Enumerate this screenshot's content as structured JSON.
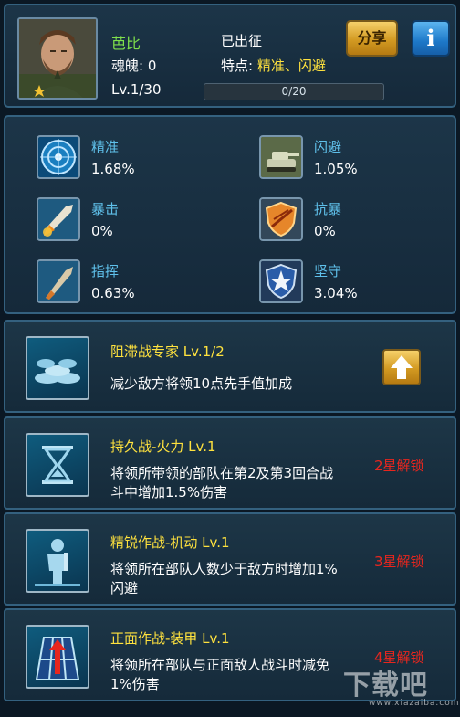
{
  "header": {
    "name": "芭比",
    "soul": "魂魄: 0",
    "level": "Lv.1/30",
    "status": "已出征",
    "trait_label": "特点: ",
    "trait_value": "精准、闪避",
    "progress_text": "0/20",
    "progress_fraction": 0,
    "share_label": "分享",
    "info_label": "i"
  },
  "stats": [
    {
      "name": "精准",
      "value": "1.68%",
      "icon": "precision-radar-icon"
    },
    {
      "name": "闪避",
      "value": "1.05%",
      "icon": "tank-icon"
    },
    {
      "name": "暴击",
      "value": "0%",
      "icon": "critical-missile-icon"
    },
    {
      "name": "抗暴",
      "value": "0%",
      "icon": "shield-resist-icon"
    },
    {
      "name": "指挥",
      "value": "0.63%",
      "icon": "command-shell-icon"
    },
    {
      "name": "坚守",
      "value": "3.04%",
      "icon": "star-shield-icon"
    }
  ],
  "skills": [
    {
      "title": "阻滞战专家 Lv.1/2",
      "desc": "减少敌方将领10点先手值加成",
      "lock": "",
      "icon": "sandbag-icon"
    },
    {
      "title": "持久战-火力 Lv.1",
      "desc": "将领所带领的部队在第2及第3回合战斗中增加1.5%伤害",
      "lock": "2星解锁",
      "icon": "hourglass-icon"
    },
    {
      "title": "精锐作战-机动 Lv.1",
      "desc": "将领所在部队人数少于敌方时增加1%闪避",
      "lock": "3星解锁",
      "icon": "soldier-icon"
    },
    {
      "title": "正面作战-装甲 Lv.1",
      "desc": "将领所在部队与正面敌人战斗时减免1%伤害",
      "lock": "4星解锁",
      "icon": "grid-arrow-icon"
    }
  ],
  "watermark": {
    "text": "下载吧",
    "url": "www.xiazaiba.com"
  }
}
